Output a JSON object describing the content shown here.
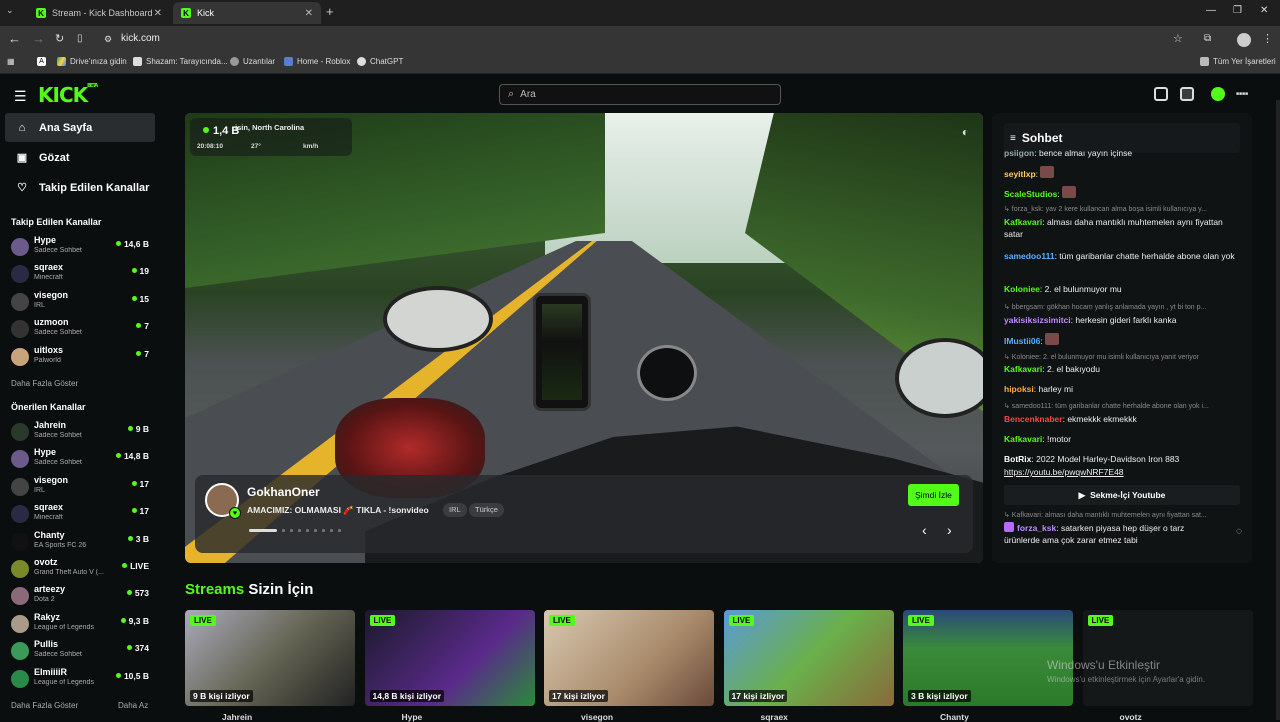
{
  "browser": {
    "tabs": [
      {
        "label": "Stream - Kick Dashboard"
      },
      {
        "label": "Kick"
      }
    ],
    "url": "kick.com",
    "bookmarks": [
      "Drive'ınıza gidin",
      "Shazam: Tarayıcında...",
      "Uzantılar",
      "Home - Roblox",
      "ChatGPT"
    ],
    "all_bookmarks": "Tüm Yer İşaretleri"
  },
  "header": {
    "logo": "KICK",
    "beta": "BETA",
    "search_placeholder": "Ara"
  },
  "sidebar": {
    "nav": [
      {
        "label": "Ana Sayfa"
      },
      {
        "label": "Gözat"
      },
      {
        "label": "Takip Edilen Kanallar"
      }
    ],
    "followed_title": "Takip Edilen Kanallar",
    "followed": [
      {
        "name": "Hype",
        "category": "Sadece Sohbet",
        "viewers": "14,6 B",
        "color": "#6b5a8a"
      },
      {
        "name": "sqraex",
        "category": "Minecraft",
        "viewers": "19",
        "color": "#2a2a44"
      },
      {
        "name": "visegon",
        "category": "IRL",
        "viewers": "15",
        "color": "#444"
      },
      {
        "name": "uzmoon",
        "category": "Sadece Sohbet",
        "viewers": "7",
        "color": "#333"
      },
      {
        "name": "uitloxs",
        "category": "Palworld",
        "viewers": "7",
        "color": "#c9a47a"
      }
    ],
    "show_more": "Daha Fazla Göster",
    "recommended_title": "Önerilen Kanallar",
    "recommended": [
      {
        "name": "Jahrein",
        "category": "Sadece Sohbet",
        "viewers": "9 B",
        "color": "#2a3a2a"
      },
      {
        "name": "Hype",
        "category": "Sadece Sohbet",
        "viewers": "14,8 B",
        "color": "#6b5a8a"
      },
      {
        "name": "visegon",
        "category": "IRL",
        "viewers": "17",
        "color": "#444"
      },
      {
        "name": "sqraex",
        "category": "Minecraft",
        "viewers": "17",
        "color": "#2a2a44"
      },
      {
        "name": "Chanty",
        "category": "EA Sports FC 26",
        "viewers": "3 B",
        "color": "#111"
      },
      {
        "name": "ovotz",
        "category": "Grand Theft Auto V (...",
        "viewers": "LIVE",
        "color": "#7a8a2a"
      },
      {
        "name": "arteezy",
        "category": "Dota 2",
        "viewers": "573",
        "color": "#8a6a7a"
      },
      {
        "name": "Rakyz",
        "category": "League of Legends",
        "viewers": "9,3 B",
        "color": "#aa9a8a"
      },
      {
        "name": "Pullis",
        "category": "Sadece Sohbet",
        "viewers": "374",
        "color": "#3a9a5a"
      },
      {
        "name": "EImiiiiR",
        "category": "League of Legends",
        "viewers": "10,5 B",
        "color": "#2a8a4a"
      }
    ],
    "show_more2": "Daha Fazla Göster",
    "show_less": "Daha Az"
  },
  "hero": {
    "viewers": "1,4 B",
    "location": "isin, North Carolina",
    "time": "20:08:10",
    "temp": "27°",
    "speed": "km/h",
    "streamer": "GokhanOner",
    "title": "AMACIMIZ: OLMAMASI 🧨 TIKLA - !sonvideo",
    "tags": [
      "IRL",
      "Türkçe"
    ],
    "watch_label": "Şimdi İzle"
  },
  "chat": {
    "title": "Sohbet",
    "items": [
      {
        "type": "msg",
        "user": "psiigon",
        "text": "bence almaı yayın içinse",
        "color": "#9aa"
      },
      {
        "type": "msg",
        "user": "seyitlxp",
        "text": "",
        "color": "#ffcc66"
      },
      {
        "type": "msg",
        "user": "ScaleStudios",
        "text": "",
        "color": "#53fc18"
      },
      {
        "type": "reply",
        "text": "↳ forza_ksk: yav 2 kere kullancan alma boşa isimli kullanıcıya y..."
      },
      {
        "type": "msg",
        "user": "Kafkavari",
        "text": "alması daha mantıklı muhtemelen aynı fiyattan satar",
        "color": "#53fc18"
      },
      {
        "type": "msg",
        "user": "samedoo111",
        "text": "tüm garibanlar chatte herhalde abone olan yok",
        "color": "#5ab0ff"
      },
      {
        "type": "msg",
        "user": "Koloniee",
        "text": "2. el bulunmuyor mu",
        "color": "#53fc18"
      },
      {
        "type": "reply",
        "text": "↳ bbergsam: gökhan hocam yanlış anlamada yayın , yt bi ton p..."
      },
      {
        "type": "msg",
        "user": "yakisiksizsimitci",
        "text": "herkesin gideri farklı kanka",
        "color": "#c08aff"
      },
      {
        "type": "msg",
        "user": "IMustii06",
        "text": "",
        "color": "#5ab0ff"
      },
      {
        "type": "reply",
        "text": "↳ Koloniee: 2. el bulunmuyor mu isimli kullanıcıya yanıt veriyor"
      },
      {
        "type": "msg",
        "user": "Kafkavari",
        "text": "2. el bakıyodu",
        "color": "#53fc18"
      },
      {
        "type": "msg",
        "user": "hipoksi",
        "text": "harley mi",
        "color": "#ffaa44"
      },
      {
        "type": "reply",
        "text": "↳ samedoo111: tüm garibanlar chatte herhalde abone olan yok i..."
      },
      {
        "type": "msg",
        "user": "Bencenknaber",
        "text": "ekmekkk ekmekkk",
        "color": "#ff4444"
      },
      {
        "type": "msg",
        "user": "Kafkavari",
        "text": "!motor",
        "color": "#53fc18"
      },
      {
        "type": "msg",
        "user": "BotRix",
        "text": "2022 Model Harley-Davidson Iron 883",
        "color": "#fff"
      },
      {
        "type": "link",
        "text": "https://youtu.be/pwqwNRF7E48"
      }
    ],
    "yt_button": "Sekme-İçi Youtube",
    "reply_last": "↳ Kafkavari: alması daha mantıklı muhtemelen aynı fiyattan sat...",
    "last_user": "forza_ksk",
    "last_text": "satarken piyasa hep düşer o tarz ürünlerde ama çok zarar etmez tabi"
  },
  "streams": {
    "heading_highlight": "Streams",
    "heading_rest": "Sizin İçin",
    "live_label": "LIVE",
    "cards": [
      {
        "viewers": "9 B kişi izliyor",
        "name": "Jahrein",
        "bg": "linear-gradient(135deg,#aab,#665 50%,#222)"
      },
      {
        "viewers": "14,8 B kişi izliyor",
        "name": "Hype",
        "bg": "linear-gradient(135deg,#1a1a2a,#5a2a8a 60%,#2a8a3a)"
      },
      {
        "viewers": "17 kişi izliyor",
        "name": "visegon",
        "bg": "linear-gradient(135deg,#d8c8b0,#a88a6a 60%,#6a4a3a)"
      },
      {
        "viewers": "17 kişi izliyor",
        "name": "sqraex",
        "bg": "linear-gradient(135deg,#5a9ad8,#6ab04a 50%,#8a6a3a)"
      },
      {
        "viewers": "3 B kişi izliyor",
        "name": "Chanty",
        "bg": "linear-gradient(180deg,#2a4a7a,#3a8a3a 40%,#2a7a2a)"
      },
      {
        "viewers": "",
        "name": "ovotz",
        "bg": "#151819"
      }
    ]
  },
  "windows_activation": {
    "title": "Windows'u Etkinleştir",
    "subtitle": "Windows'u etkinleştirmek için Ayarlar'a gidin."
  }
}
